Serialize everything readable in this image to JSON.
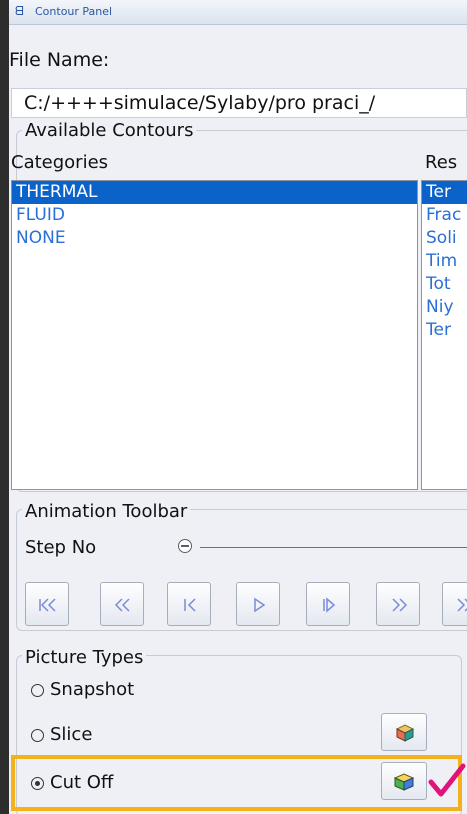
{
  "panel": {
    "title": "Contour Panel",
    "file_name_label": "File Name:",
    "file_path": "C:/++++simulace/Sylaby/pro praci_/"
  },
  "contours": {
    "group_title": "Available Contours",
    "categories_header": "Categories",
    "results_header": "Res",
    "categories": [
      "THERMAL",
      "FLUID",
      "NONE"
    ],
    "selected_category": "THERMAL",
    "results_visible": [
      "Ter",
      "Frac",
      "Soli",
      "Tim",
      "Tot",
      "Niy",
      "Ter"
    ]
  },
  "animation": {
    "group_title": "Animation Toolbar",
    "step_label": "Step No",
    "step_value": 0,
    "buttons": [
      "first-frame",
      "rewind",
      "step-back",
      "play",
      "step-forward",
      "fast-forward",
      "last-frame"
    ]
  },
  "picture_types": {
    "group_title": "Picture Types",
    "options": [
      "Snapshot",
      "Slice",
      "Cut Off"
    ],
    "selected": "Cut Off"
  },
  "colors": {
    "accent": "#0b63c9",
    "list_text": "#2a6fd6",
    "highlight": "#f3b21b",
    "checkmark": "#e0137a"
  }
}
